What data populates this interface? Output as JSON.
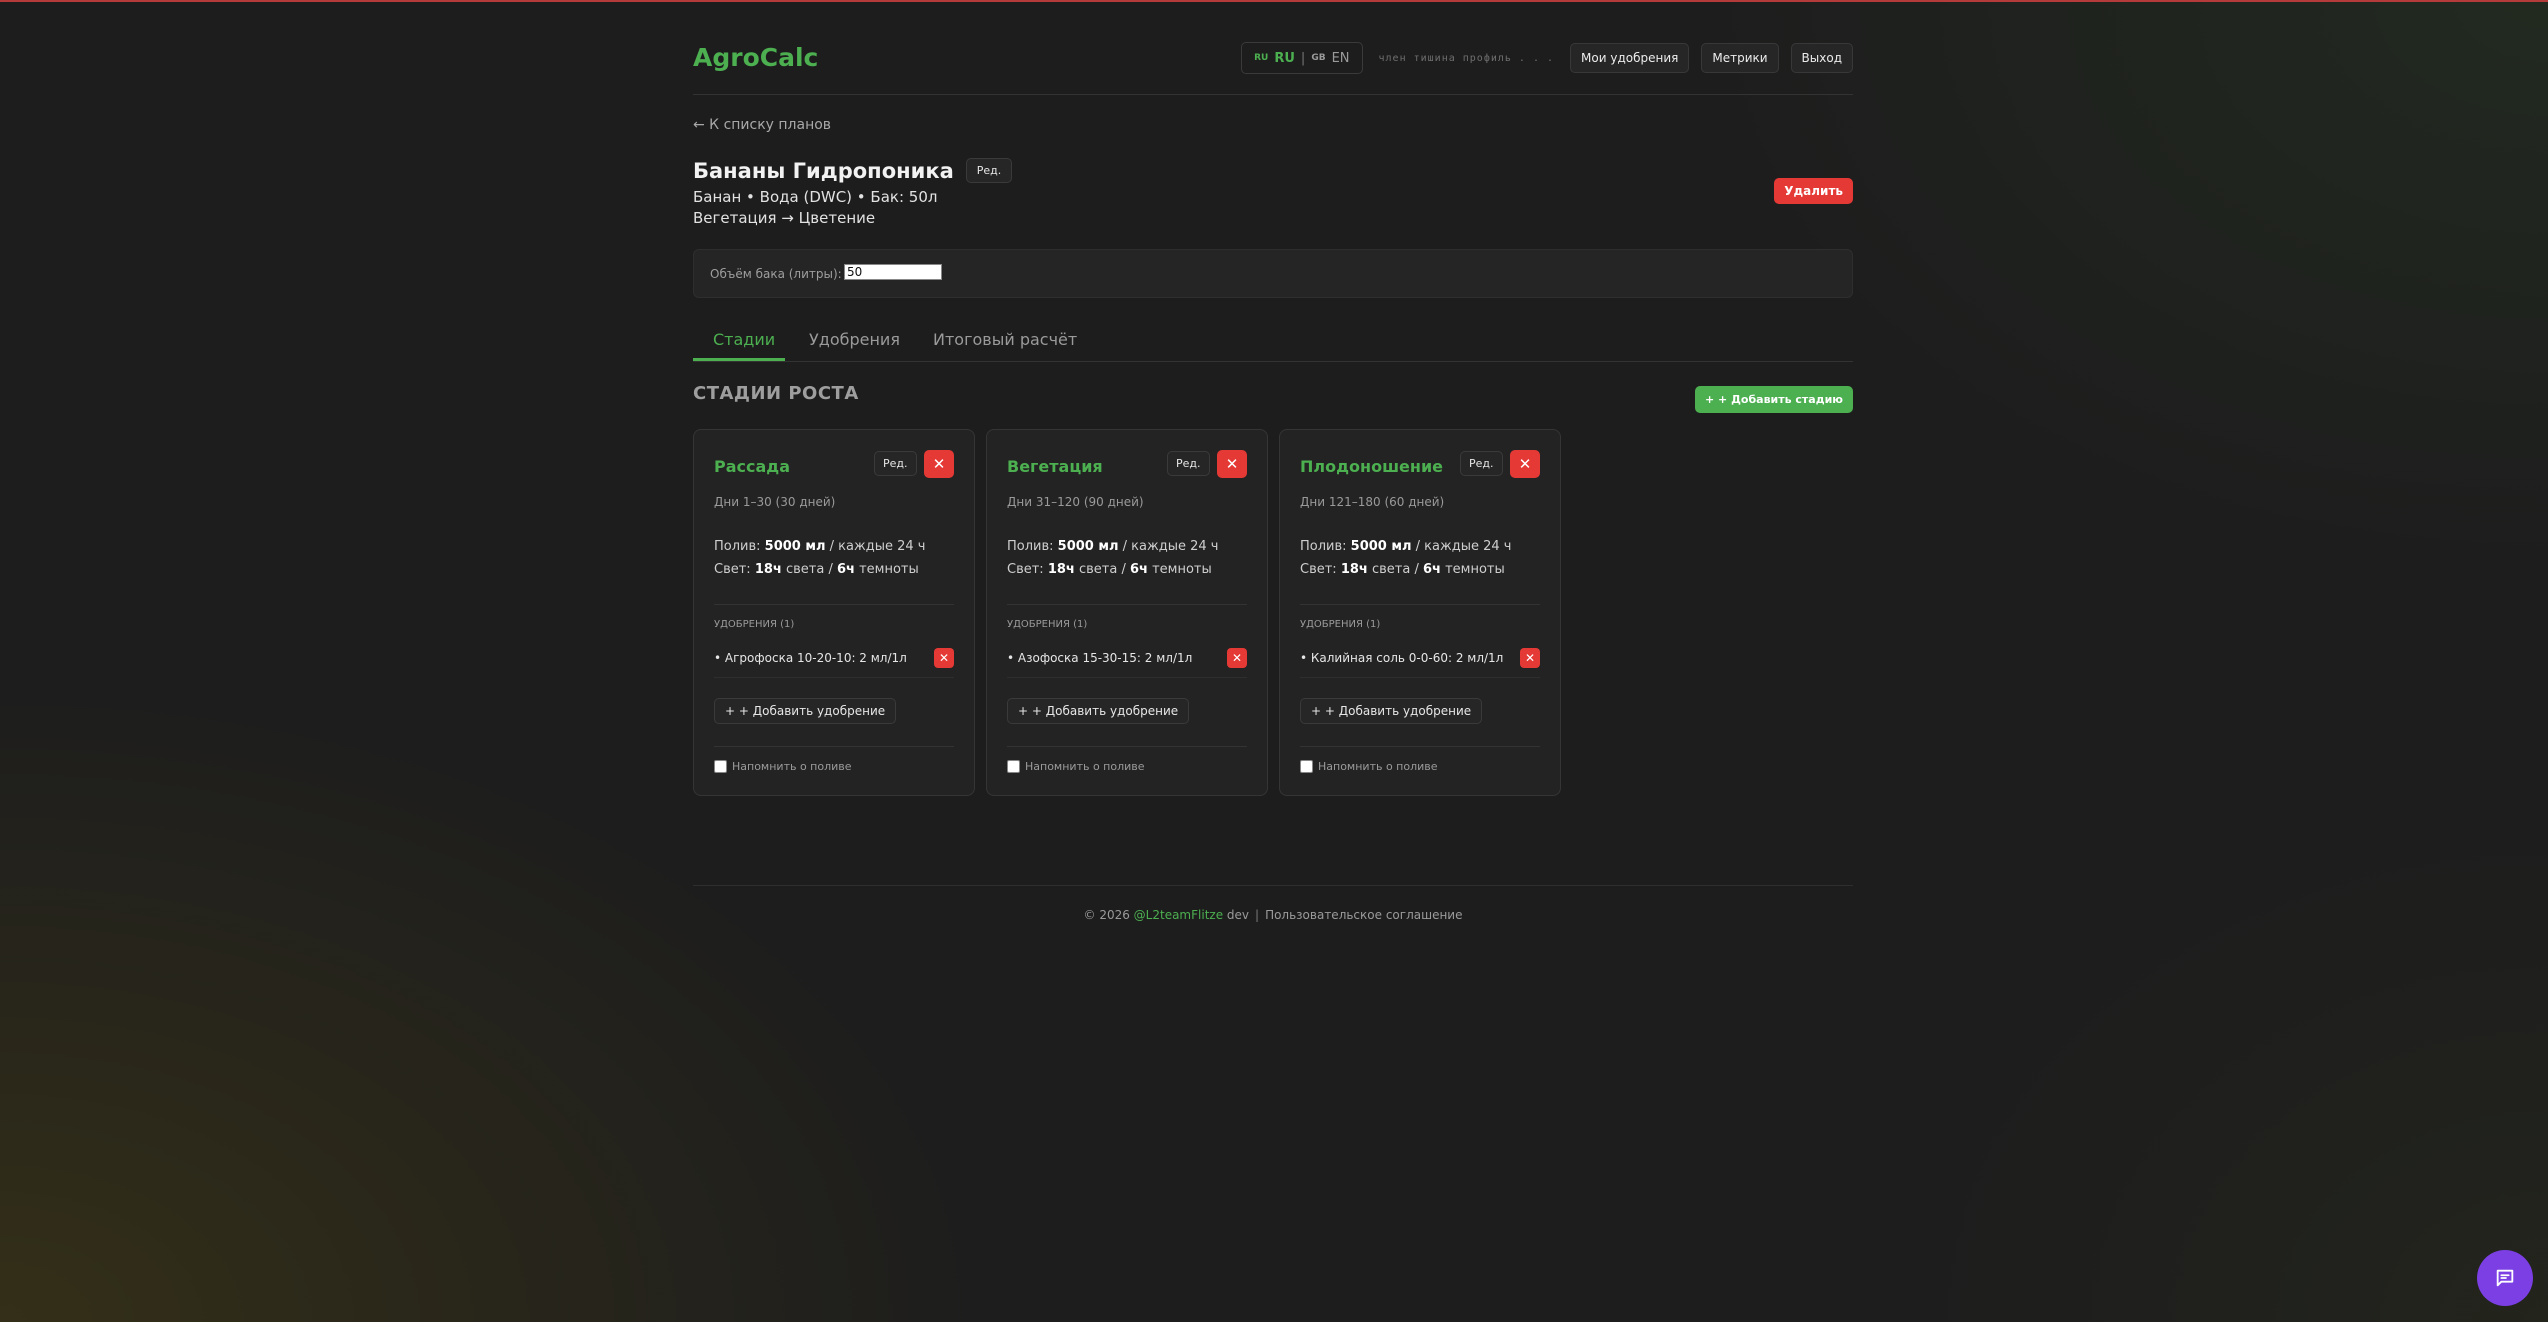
{
  "app": {
    "name": "AgroCalc"
  },
  "header": {
    "lang_ru_flag": "RU",
    "lang_ru": "RU",
    "lang_sep": "|",
    "lang_en_flag": "GB",
    "lang_en": "EN",
    "user_line": "члeн  тишина  профиль  . . .",
    "nav": [
      "Мои удобрения",
      "Метрики",
      "Выход"
    ]
  },
  "back_link": "← К списку планов",
  "plan": {
    "title": "Бананы Гидропоника",
    "edit_label": "Ред.",
    "meta_line1": "Банан • Вода (DWC) • Бак: 50л",
    "meta_line2": "Вегетация → Цветение",
    "delete_label": "Удалить"
  },
  "tank": {
    "label": "Объём бака (литры):",
    "value": "50"
  },
  "tabs": [
    "Стадии",
    "Удобрения",
    "Итоговый расчёт"
  ],
  "stages_section": {
    "title": "СТАДИИ РОСТА",
    "add_label": "+ + Добавить стадию"
  },
  "stages": [
    {
      "name": "Рассада",
      "edit": "Ред.",
      "close": "✕",
      "days": "Дни 1–30 (30 дней)",
      "water_prefix": "Полив: ",
      "water_value": "5000 мл",
      "water_suffix": " / каждые 24 ч",
      "light_prefix": "Свет: ",
      "light_value": "18ч",
      "light_mid": " света / ",
      "dark_value": "6ч",
      "light_suffix": " темноты",
      "fert_title": "УДОБРЕНИЯ (1)",
      "fert_item": "• Агрофоска 10-20-10: 2 мл/1л",
      "fert_remove": "✕",
      "add_fert": "+ + Добавить удобрение",
      "remind": "Напомнить о поливе"
    },
    {
      "name": "Вегетация",
      "edit": "Ред.",
      "close": "✕",
      "days": "Дни 31–120 (90 дней)",
      "water_prefix": "Полив: ",
      "water_value": "5000 мл",
      "water_suffix": " / каждые 24 ч",
      "light_prefix": "Свет: ",
      "light_value": "18ч",
      "light_mid": " света / ",
      "dark_value": "6ч",
      "light_suffix": " темноты",
      "fert_title": "УДОБРЕНИЯ (1)",
      "fert_item": "• Азофоска 15-30-15: 2 мл/1л",
      "fert_remove": "✕",
      "add_fert": "+ + Добавить удобрение",
      "remind": "Напомнить о поливе"
    },
    {
      "name": "Плодоношение",
      "edit": "Ред.",
      "close": "✕",
      "days": "Дни 121–180 (60 дней)",
      "water_prefix": "Полив: ",
      "water_value": "5000 мл",
      "water_suffix": " / каждые 24 ч",
      "light_prefix": "Свет: ",
      "light_value": "18ч",
      "light_mid": " света / ",
      "dark_value": "6ч",
      "light_suffix": " темноты",
      "fert_title": "УДОБРЕНИЯ (1)",
      "fert_item": "• Калийная соль 0-0-60: 2 мл/1л",
      "fert_remove": "✕",
      "add_fert": "+ + Добавить удобрение",
      "remind": "Напомнить о поливе"
    }
  ],
  "footer": {
    "copyright": "© 2026 ",
    "brand": "@L2teamFlitze",
    "dev": " dev",
    "sep": "|",
    "terms": "Пользовательское соглашение"
  },
  "icons": {
    "chat": "chat-bubble-icon",
    "close": "close-icon"
  },
  "colors": {
    "accent": "#4caf50",
    "danger": "#e53935",
    "chat": "#7b3fe4",
    "background": "#1d1d1d"
  }
}
